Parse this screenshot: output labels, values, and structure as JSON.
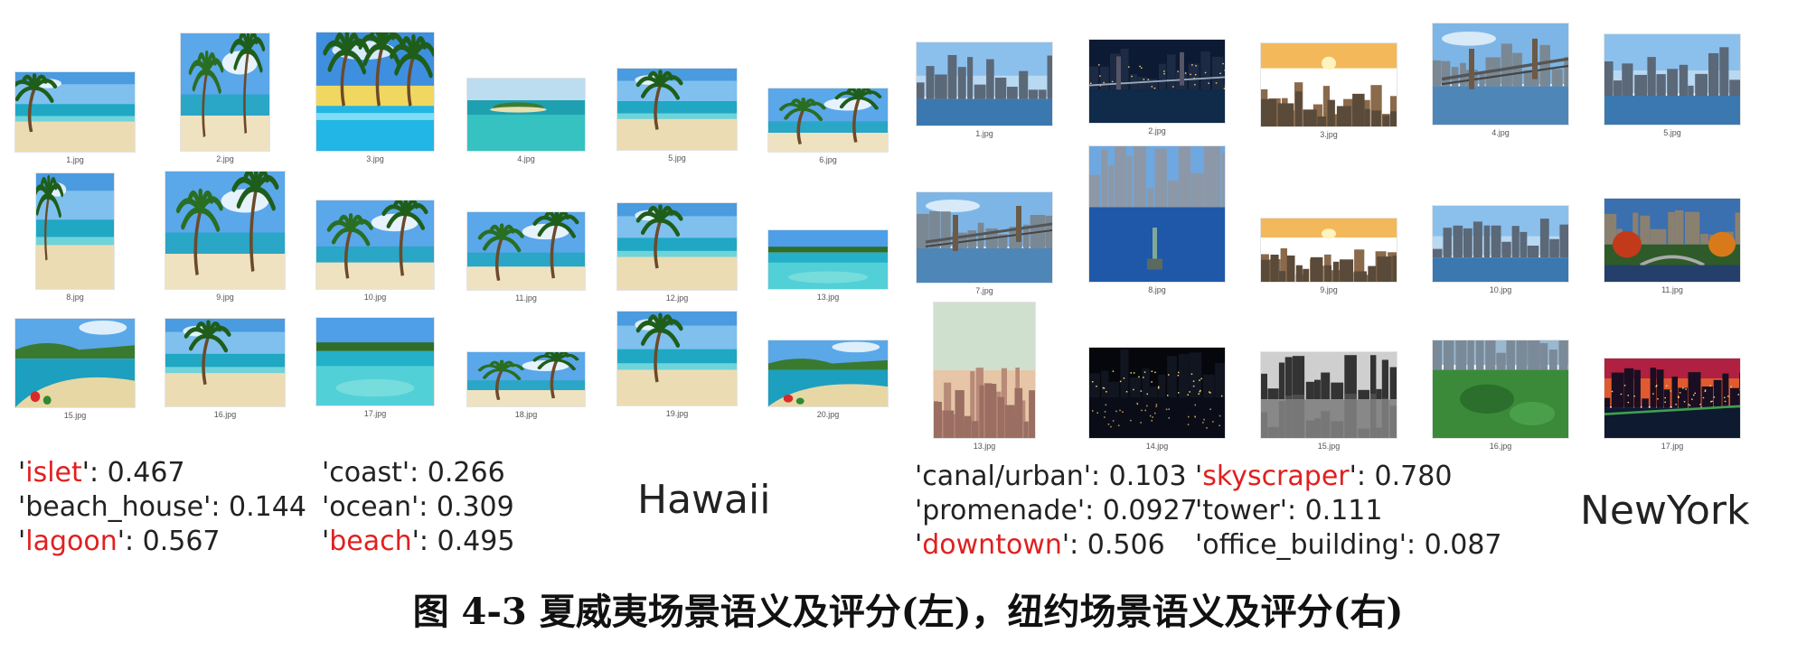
{
  "hawaii": {
    "place_label": "Hawaii",
    "images": [
      {
        "name": "1.jpg",
        "scene": "beach"
      },
      {
        "name": "2.jpg",
        "scene": "palm"
      },
      {
        "name": "3.jpg",
        "scene": "pool"
      },
      {
        "name": "4.jpg",
        "scene": "islet"
      },
      {
        "name": "5.jpg",
        "scene": "beach"
      },
      {
        "name": "6.jpg",
        "scene": "palm"
      },
      {
        "name": "8.jpg",
        "scene": "beach"
      },
      {
        "name": "9.jpg",
        "scene": "palm"
      },
      {
        "name": "10.jpg",
        "scene": "palm"
      },
      {
        "name": "11.jpg",
        "scene": "palm"
      },
      {
        "name": "12.jpg",
        "scene": "beach"
      },
      {
        "name": "13.jpg",
        "scene": "lagoon"
      },
      {
        "name": "15.jpg",
        "scene": "coast"
      },
      {
        "name": "16.jpg",
        "scene": "beach"
      },
      {
        "name": "17.jpg",
        "scene": "lagoon"
      },
      {
        "name": "18.jpg",
        "scene": "palm"
      },
      {
        "name": "19.jpg",
        "scene": "beach"
      },
      {
        "name": "20.jpg",
        "scene": "coast"
      }
    ],
    "scores_left": [
      {
        "term": "islet",
        "highlight": true,
        "score": "0.467"
      },
      {
        "term": "beach_house",
        "highlight": false,
        "score": "0.144"
      },
      {
        "term": "lagoon",
        "highlight": true,
        "score": "0.567"
      }
    ],
    "scores_right": [
      {
        "term": "coast",
        "highlight": false,
        "score": "0.266"
      },
      {
        "term": "ocean",
        "highlight": false,
        "score": "0.309"
      },
      {
        "term": "beach",
        "highlight": true,
        "score": "0.495"
      }
    ]
  },
  "newyork": {
    "place_label": "NewYork",
    "images": [
      {
        "name": "1.jpg",
        "scene": "skyline"
      },
      {
        "name": "2.jpg",
        "scene": "bridge-night"
      },
      {
        "name": "3.jpg",
        "scene": "aerial"
      },
      {
        "name": "4.jpg",
        "scene": "bridge"
      },
      {
        "name": "5.jpg",
        "scene": "skyline"
      },
      {
        "name": "7.jpg",
        "scene": "bridge"
      },
      {
        "name": "8.jpg",
        "scene": "harbor"
      },
      {
        "name": "9.jpg",
        "scene": "aerial"
      },
      {
        "name": "10.jpg",
        "scene": "skyline"
      },
      {
        "name": "11.jpg",
        "scene": "park"
      },
      {
        "name": "13.jpg",
        "scene": "vintage"
      },
      {
        "name": "14.jpg",
        "scene": "night"
      },
      {
        "name": "15.jpg",
        "scene": "bw"
      },
      {
        "name": "16.jpg",
        "scene": "central-park"
      },
      {
        "name": "17.jpg",
        "scene": "sunset"
      }
    ],
    "scores_left": [
      {
        "term": "canal/urban",
        "highlight": false,
        "score": "0.103"
      },
      {
        "term": "promenade",
        "highlight": false,
        "score": "0.0927"
      },
      {
        "term": "downtown",
        "highlight": true,
        "score": "0.506"
      }
    ],
    "scores_right": [
      {
        "term": "skyscraper",
        "highlight": true,
        "score": "0.780"
      },
      {
        "term": "tower",
        "highlight": false,
        "score": "0.111"
      },
      {
        "term": "office_building",
        "highlight": false,
        "score": "0.087"
      }
    ]
  },
  "caption": "图 4-3 夏威夷场景语义及评分(左)，纽约场景语义及评分(右)"
}
